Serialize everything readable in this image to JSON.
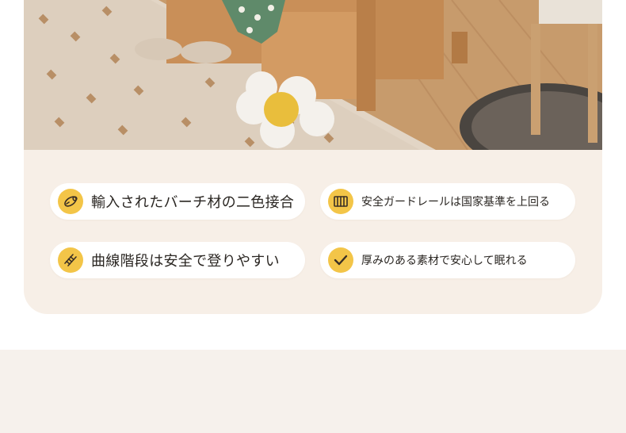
{
  "features": [
    {
      "label": "輸入されたバーチ材の二色接合",
      "icon": "wood-log-icon"
    },
    {
      "label": "安全ガードレールは国家基準を上回る",
      "icon": "guardrail-icon"
    },
    {
      "label": "曲線階段は安全で登りやすい",
      "icon": "ladder-icon"
    },
    {
      "label": "厚みのある素材で安心して眠れる",
      "icon": "checkmark-icon"
    }
  ],
  "colors": {
    "badge": "#f3c548",
    "card": "#f7efe7",
    "band": "#f6f1ec",
    "text": "#2a2622"
  }
}
